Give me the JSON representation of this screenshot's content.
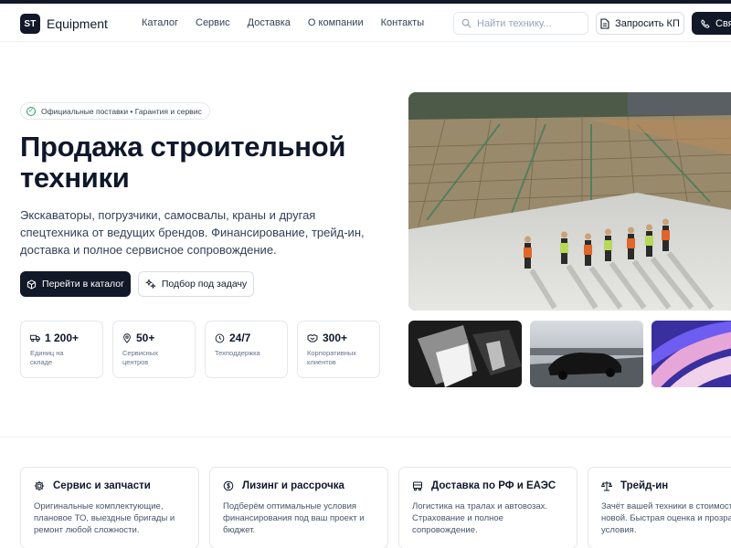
{
  "header": {
    "logo_mark": "ST",
    "logo_text": "Equipment",
    "nav": [
      "Каталог",
      "Сервис",
      "Доставка",
      "О компании",
      "Контакты"
    ],
    "search_placeholder": "Найти технику...",
    "request_label": "Запросить КП",
    "call_label": "Свя"
  },
  "hero": {
    "badge": "Официальные поставки • Гарантия и сервис",
    "title": "Продажа строительной техники",
    "lead": "Экскаваторы, погрузчики, самосвалы, краны и другая спецтехника от ведущих брендов. Финансирование, трейд-ин, доставка и полное сервисное сопровождение.",
    "primary_button": "Перейти в каталог",
    "secondary_button": "Подбор под задачу",
    "stats": [
      {
        "icon": "truck-icon",
        "value": "1 200+",
        "label": "Единиц на складе"
      },
      {
        "icon": "map-pin-icon",
        "value": "50+",
        "label": "Сервисных центров"
      },
      {
        "icon": "clock-icon",
        "value": "24/7",
        "label": "Техподдержка"
      },
      {
        "icon": "handshake-icon",
        "value": "300+",
        "label": "Корпоративных клиентов"
      }
    ]
  },
  "features": [
    {
      "icon": "gear-icon",
      "title": "Сервис и запчасти",
      "text": "Оригинальные комплектующие, плановое ТО, выездные бригады и ремонт любой сложности."
    },
    {
      "icon": "coin-icon",
      "title": "Лизинг и рассрочка",
      "text": "Подберём оптимальные условия финансирования под ваш проект и бюджет."
    },
    {
      "icon": "delivery-truck-icon",
      "title": "Доставка по РФ и ЕАЭС",
      "text": "Логистика на тралах и автовозах. Страхование и полное сопровождение."
    },
    {
      "icon": "scales-icon",
      "title": "Трейд-ин",
      "text": "Зачёт вашей техники в стоимость новой. Быстрая оценка и прозрачные условия."
    }
  ]
}
